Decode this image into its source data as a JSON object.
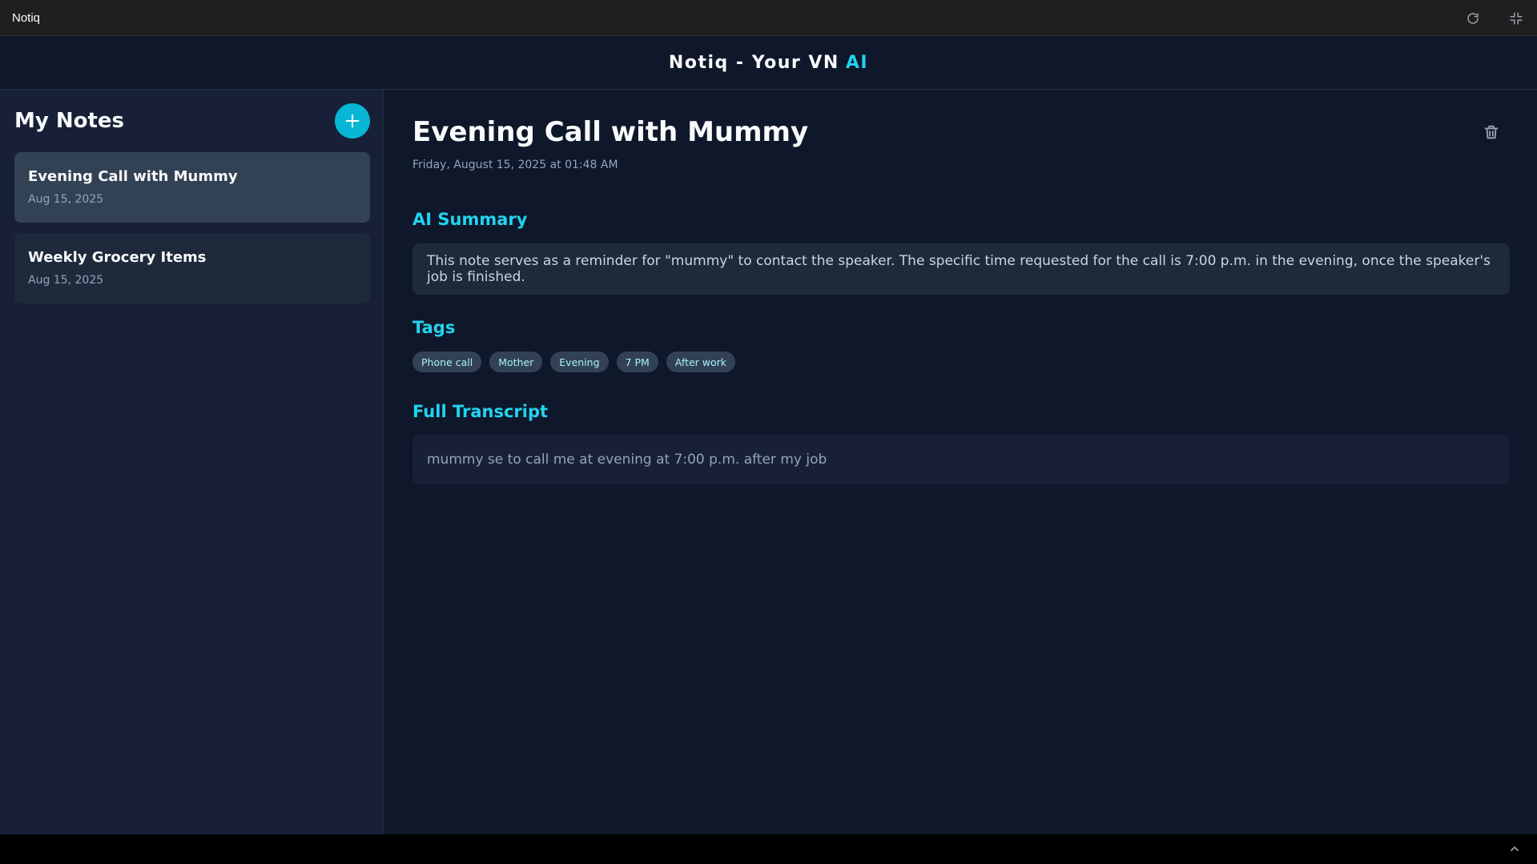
{
  "window": {
    "title": "Notiq"
  },
  "header": {
    "title": "Notiq - Your VN",
    "accent": "AI"
  },
  "sidebar": {
    "title": "My Notes",
    "notes": [
      {
        "title": "Evening Call with Mummy",
        "date": "Aug 15, 2025",
        "active": true
      },
      {
        "title": "Weekly Grocery Items",
        "date": "Aug 15, 2025",
        "active": false
      }
    ]
  },
  "note": {
    "title": "Evening Call with Mummy",
    "datetime": "Friday, August 15, 2025 at 01:48 AM",
    "summary_heading": "AI Summary",
    "summary": "This note serves as a reminder for \"mummy\" to contact the speaker. The specific time requested for the call is 7:00 p.m. in the evening, once the speaker's job is finished.",
    "tags_heading": "Tags",
    "tags": [
      "Phone call",
      "Mother",
      "Evening",
      "7 PM",
      "After work"
    ],
    "transcript_heading": "Full Transcript",
    "transcript": "mummy se to call me at evening at 7:00 p.m. after my job"
  },
  "colors": {
    "accent": "#22d3ee",
    "add_button": "#06b6d4",
    "background": "#0f172a"
  },
  "icons": [
    "refresh-icon",
    "compress-icon",
    "plus-icon",
    "trash-icon",
    "chevron-up-icon"
  ]
}
